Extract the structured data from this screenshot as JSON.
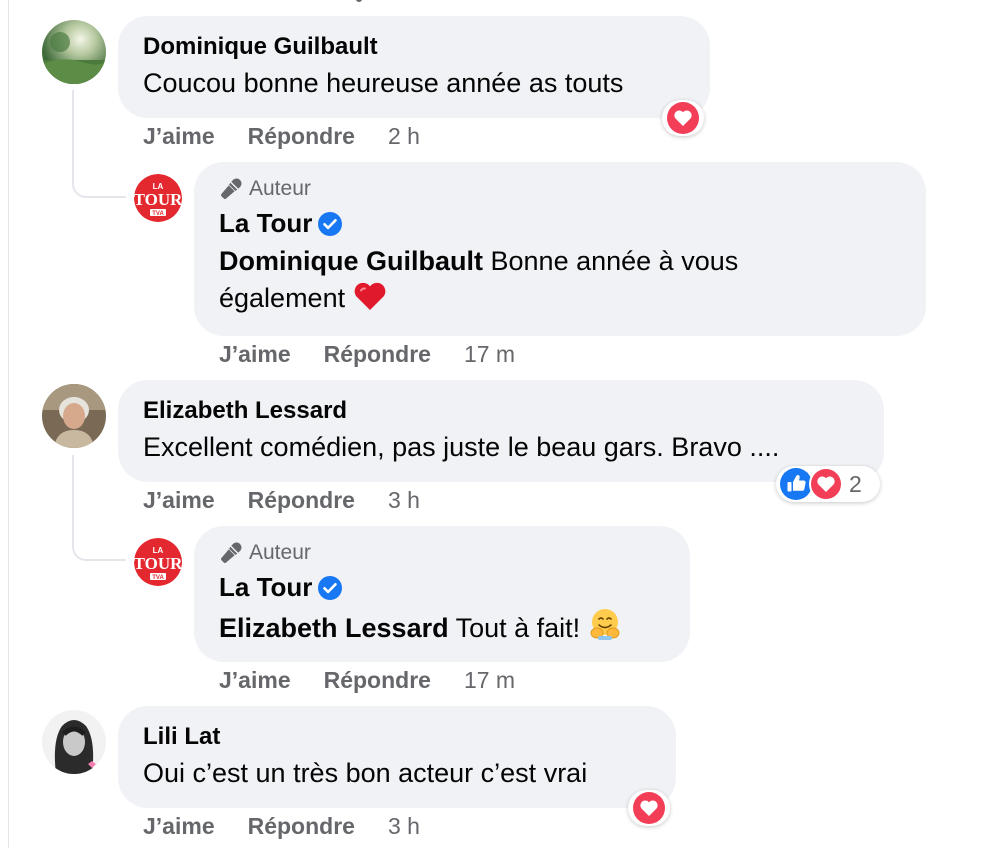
{
  "labels": {
    "like": "J’aime",
    "reply": "Répondre",
    "author_badge": "Auteur"
  },
  "colors": {
    "bubble_bg": "#f0f2f5",
    "secondary_text": "#65676b",
    "verified_blue": "#1877f2",
    "like_blue": "#1877f2",
    "love_red": "#f33e58",
    "la_tour_red": "#e4282f"
  },
  "comments": [
    {
      "author": "Dominique Guilbault",
      "text": "Coucou bonne heureuse année as touts",
      "time": "2 h",
      "reactions": [
        "love-icon"
      ],
      "reply": {
        "badge": "Auteur",
        "author": "La Tour",
        "verified": true,
        "mention": "Dominique Guilbault",
        "text_line1": "Bonne année à vous",
        "text_line2": "également",
        "emoji": "red-heart-icon",
        "time": "17 m"
      }
    },
    {
      "author": "Elizabeth Lessard",
      "text": "Excellent comédien, pas juste le beau gars. Bravo ....",
      "time": "3 h",
      "reactions": [
        "like-icon",
        "love-icon"
      ],
      "reaction_count": "2",
      "reply": {
        "badge": "Auteur",
        "author": "La Tour",
        "verified": true,
        "mention": "Elizabeth Lessard",
        "text": "Tout à fait!",
        "emoji": "hugging-face-icon",
        "time": "17 m"
      }
    },
    {
      "author": "Lili Lat",
      "text": "Oui c’est un très bon acteur c’est vrai",
      "time": "3 h",
      "reactions": [
        "love-icon"
      ]
    }
  ],
  "la_tour_logo": {
    "line1": "LA",
    "line2": "TOUR",
    "line3": "TVA"
  }
}
